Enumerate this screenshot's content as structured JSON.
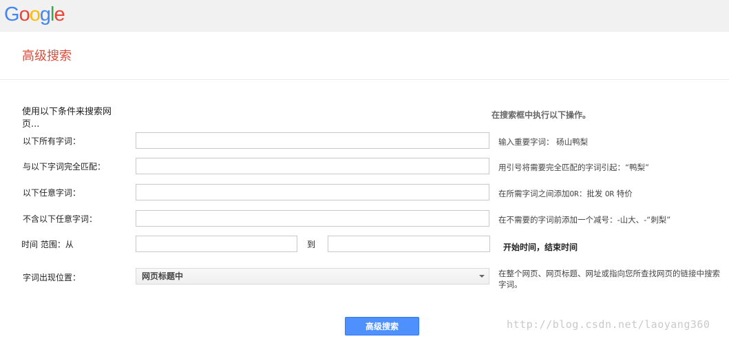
{
  "logo": {
    "letters": [
      "G",
      "o",
      "o",
      "g",
      "l",
      "e"
    ],
    "colors": [
      "#4285f4",
      "#ea4335",
      "#fbbc05",
      "#4285f4",
      "#34a853",
      "#ea4335"
    ]
  },
  "page_title": "高级搜索",
  "intro": "使用以下条件来搜索网页...",
  "hint_header": "在搜索框中执行以下操作。",
  "rows": {
    "all_words": {
      "label": "以下所有字词：",
      "value": "",
      "hint": "输入重要字词： 砀山鸭梨"
    },
    "exact_phrase": {
      "label": "与以下字词完全匹配：",
      "value": "",
      "hint": "用引号将需要完全匹配的字词引起：“鸭梨”"
    },
    "any_words": {
      "label": "以下任意字词：",
      "value": "",
      "hint_prefix": "在所需字词之间添加",
      "hint_mono1": "OR",
      "hint_mid": "：批发 ",
      "hint_mono2": "OR",
      "hint_suffix": " 特价"
    },
    "none_words": {
      "label": "不含以下任意字词：",
      "value": "",
      "hint": "在不需要的字词前添加一个减号：-山大、-“刺梨”"
    },
    "time_range": {
      "label": "时间 范围：从",
      "from_value": "",
      "to_label": "到",
      "to_value": "",
      "hint": "开始时间，结束时间"
    },
    "term_location": {
      "label": "字词出现位置：",
      "selected": "网页标题中",
      "hint": "在整个网页、网页标题、网址或指向您所查找网页的链接中搜索字词。"
    }
  },
  "search_button": "高级搜索",
  "watermark": "http://blog.csdn.net/laoyang360"
}
